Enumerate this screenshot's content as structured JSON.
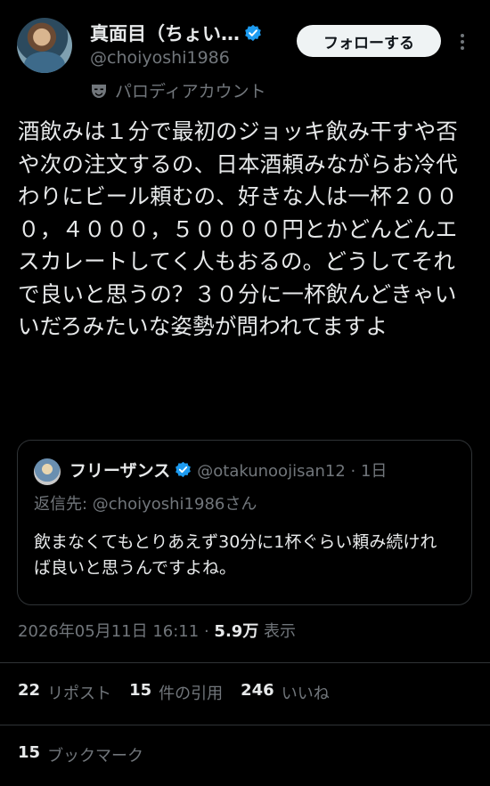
{
  "author": {
    "display_name": "真面目（ちょい…",
    "handle": "@choiyoshi1986",
    "label": "パロディアカウント"
  },
  "follow_button": "フォローする",
  "post": {
    "text": "酒飲みは１分で最初のジョッキ飲み干すや否や次の注文するの、日本酒頼みながらお冷代わりにビール頼むの、好きな人は一杯２０００，４０００，５００００円とかどんどんエスカレートしてく人もおるの。どうしてそれで良いと思うの？３０分に一杯飲んどきゃいいだろみたいな姿勢が問われてますよ"
  },
  "quote": {
    "display_name": "フリーザンス",
    "handle_time": "@otakunoojisan12 · 1日",
    "reply_to": "返信先: @choiyoshi1986さん",
    "text": "飲まなくてもとりあえず30分に1杯ぐらい頼み続ければ良いと思うんですよね。"
  },
  "meta": {
    "timestamp": "2026年05月11日 16:11",
    "separator": "·",
    "views_count": "5.9万",
    "views_label": "表示"
  },
  "stats": {
    "reposts_count": "22",
    "reposts_label": "リポスト",
    "quotes_count": "15",
    "quotes_label": "件の引用",
    "likes_count": "246",
    "likes_label": "いいね",
    "bookmarks_count": "15",
    "bookmarks_label": "ブックマーク"
  },
  "colors": {
    "background": "#000000",
    "text": "#e7e9ea",
    "muted": "#71767b",
    "verified": "#1d9bf0",
    "border": "#2f3336"
  },
  "icons": [
    "verified-badge-icon",
    "parody-mask-icon",
    "more-options-icon"
  ]
}
